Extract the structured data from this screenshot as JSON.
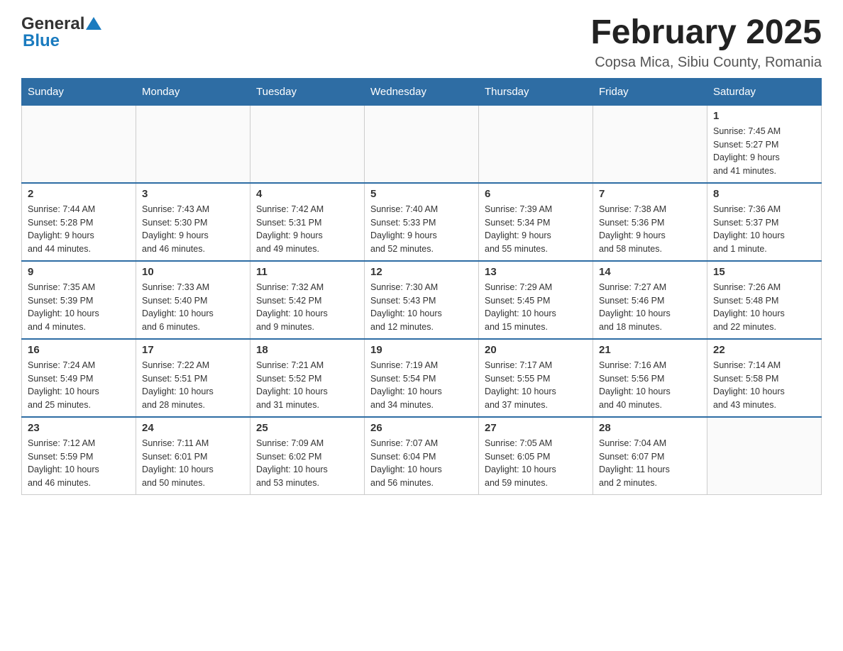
{
  "header": {
    "logo_line1": "General",
    "logo_line2": "Blue",
    "month_title": "February 2025",
    "subtitle": "Copsa Mica, Sibiu County, Romania"
  },
  "weekdays": [
    "Sunday",
    "Monday",
    "Tuesday",
    "Wednesday",
    "Thursday",
    "Friday",
    "Saturday"
  ],
  "weeks": [
    [
      {
        "day": "",
        "info": ""
      },
      {
        "day": "",
        "info": ""
      },
      {
        "day": "",
        "info": ""
      },
      {
        "day": "",
        "info": ""
      },
      {
        "day": "",
        "info": ""
      },
      {
        "day": "",
        "info": ""
      },
      {
        "day": "1",
        "info": "Sunrise: 7:45 AM\nSunset: 5:27 PM\nDaylight: 9 hours\nand 41 minutes."
      }
    ],
    [
      {
        "day": "2",
        "info": "Sunrise: 7:44 AM\nSunset: 5:28 PM\nDaylight: 9 hours\nand 44 minutes."
      },
      {
        "day": "3",
        "info": "Sunrise: 7:43 AM\nSunset: 5:30 PM\nDaylight: 9 hours\nand 46 minutes."
      },
      {
        "day": "4",
        "info": "Sunrise: 7:42 AM\nSunset: 5:31 PM\nDaylight: 9 hours\nand 49 minutes."
      },
      {
        "day": "5",
        "info": "Sunrise: 7:40 AM\nSunset: 5:33 PM\nDaylight: 9 hours\nand 52 minutes."
      },
      {
        "day": "6",
        "info": "Sunrise: 7:39 AM\nSunset: 5:34 PM\nDaylight: 9 hours\nand 55 minutes."
      },
      {
        "day": "7",
        "info": "Sunrise: 7:38 AM\nSunset: 5:36 PM\nDaylight: 9 hours\nand 58 minutes."
      },
      {
        "day": "8",
        "info": "Sunrise: 7:36 AM\nSunset: 5:37 PM\nDaylight: 10 hours\nand 1 minute."
      }
    ],
    [
      {
        "day": "9",
        "info": "Sunrise: 7:35 AM\nSunset: 5:39 PM\nDaylight: 10 hours\nand 4 minutes."
      },
      {
        "day": "10",
        "info": "Sunrise: 7:33 AM\nSunset: 5:40 PM\nDaylight: 10 hours\nand 6 minutes."
      },
      {
        "day": "11",
        "info": "Sunrise: 7:32 AM\nSunset: 5:42 PM\nDaylight: 10 hours\nand 9 minutes."
      },
      {
        "day": "12",
        "info": "Sunrise: 7:30 AM\nSunset: 5:43 PM\nDaylight: 10 hours\nand 12 minutes."
      },
      {
        "day": "13",
        "info": "Sunrise: 7:29 AM\nSunset: 5:45 PM\nDaylight: 10 hours\nand 15 minutes."
      },
      {
        "day": "14",
        "info": "Sunrise: 7:27 AM\nSunset: 5:46 PM\nDaylight: 10 hours\nand 18 minutes."
      },
      {
        "day": "15",
        "info": "Sunrise: 7:26 AM\nSunset: 5:48 PM\nDaylight: 10 hours\nand 22 minutes."
      }
    ],
    [
      {
        "day": "16",
        "info": "Sunrise: 7:24 AM\nSunset: 5:49 PM\nDaylight: 10 hours\nand 25 minutes."
      },
      {
        "day": "17",
        "info": "Sunrise: 7:22 AM\nSunset: 5:51 PM\nDaylight: 10 hours\nand 28 minutes."
      },
      {
        "day": "18",
        "info": "Sunrise: 7:21 AM\nSunset: 5:52 PM\nDaylight: 10 hours\nand 31 minutes."
      },
      {
        "day": "19",
        "info": "Sunrise: 7:19 AM\nSunset: 5:54 PM\nDaylight: 10 hours\nand 34 minutes."
      },
      {
        "day": "20",
        "info": "Sunrise: 7:17 AM\nSunset: 5:55 PM\nDaylight: 10 hours\nand 37 minutes."
      },
      {
        "day": "21",
        "info": "Sunrise: 7:16 AM\nSunset: 5:56 PM\nDaylight: 10 hours\nand 40 minutes."
      },
      {
        "day": "22",
        "info": "Sunrise: 7:14 AM\nSunset: 5:58 PM\nDaylight: 10 hours\nand 43 minutes."
      }
    ],
    [
      {
        "day": "23",
        "info": "Sunrise: 7:12 AM\nSunset: 5:59 PM\nDaylight: 10 hours\nand 46 minutes."
      },
      {
        "day": "24",
        "info": "Sunrise: 7:11 AM\nSunset: 6:01 PM\nDaylight: 10 hours\nand 50 minutes."
      },
      {
        "day": "25",
        "info": "Sunrise: 7:09 AM\nSunset: 6:02 PM\nDaylight: 10 hours\nand 53 minutes."
      },
      {
        "day": "26",
        "info": "Sunrise: 7:07 AM\nSunset: 6:04 PM\nDaylight: 10 hours\nand 56 minutes."
      },
      {
        "day": "27",
        "info": "Sunrise: 7:05 AM\nSunset: 6:05 PM\nDaylight: 10 hours\nand 59 minutes."
      },
      {
        "day": "28",
        "info": "Sunrise: 7:04 AM\nSunset: 6:07 PM\nDaylight: 11 hours\nand 2 minutes."
      },
      {
        "day": "",
        "info": ""
      }
    ]
  ]
}
